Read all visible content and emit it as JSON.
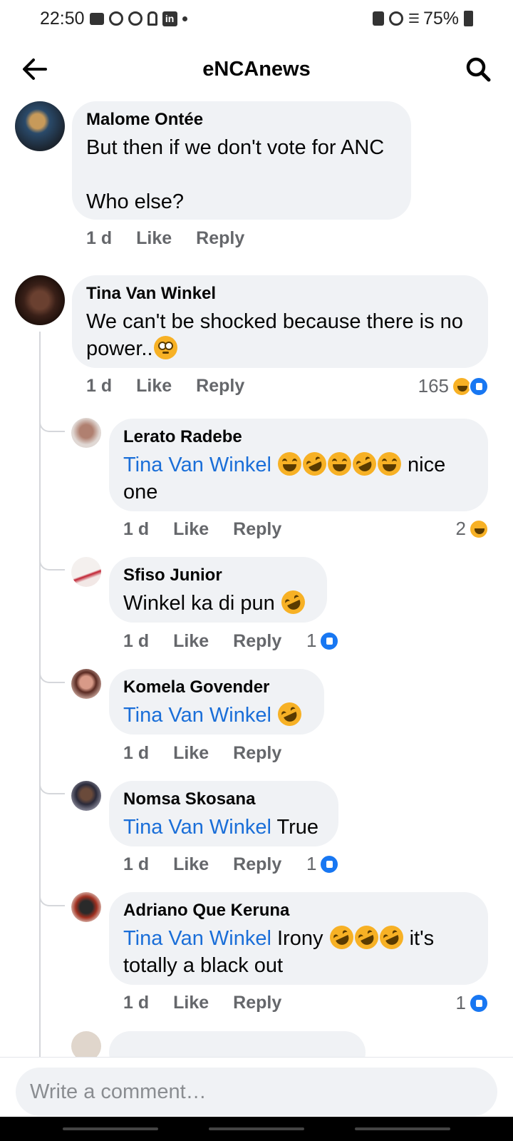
{
  "status_bar": {
    "time": "22:50",
    "battery": "75%"
  },
  "header": {
    "title": "eNCAnews"
  },
  "comments": [
    {
      "author": "Malome Ontée",
      "text": "But then if we don't vote for ANC\n\nWho else?",
      "time": "1 d",
      "like": "Like",
      "reply": "Reply"
    },
    {
      "author": "Tina Van Winkel",
      "text": "We can't be shocked because there is no power..",
      "time": "1 d",
      "like": "Like",
      "reply": "Reply",
      "reactions": "165"
    }
  ],
  "replies": [
    {
      "author": "Lerato Radebe",
      "mention": "Tina Van Winkel",
      "text_after": "nice one",
      "time": "1 d",
      "like": "Like",
      "reply": "Reply",
      "reactions": "2"
    },
    {
      "author": "Sfiso Junior",
      "text": "Winkel ka di pun",
      "time": "1 d",
      "like": "Like",
      "reply": "Reply",
      "reactions": "1"
    },
    {
      "author": "Komela Govender",
      "mention": "Tina Van Winkel",
      "time": "1 d",
      "like": "Like",
      "reply": "Reply"
    },
    {
      "author": "Nomsa Skosana",
      "mention": "Tina Van Winkel",
      "text_after": "True",
      "time": "1 d",
      "like": "Like",
      "reply": "Reply",
      "reactions": "1"
    },
    {
      "author": "Adriano Que Keruna",
      "mention": "Tina Van Winkel",
      "text_mid": "Irony",
      "text_after": "it's totally a black out",
      "time": "1 d",
      "like": "Like",
      "reply": "Reply",
      "reactions": "1"
    }
  ],
  "composer": {
    "placeholder": "Write a comment…"
  },
  "icons": {
    "back": "arrow-left-icon",
    "search": "search-icon",
    "like_reaction": "like-reaction-icon",
    "haha_reaction": "haha-reaction-icon"
  },
  "colors": {
    "mention": "#1a6ed8",
    "bubble": "#f0f2f5",
    "like_blue": "#1877f2"
  }
}
